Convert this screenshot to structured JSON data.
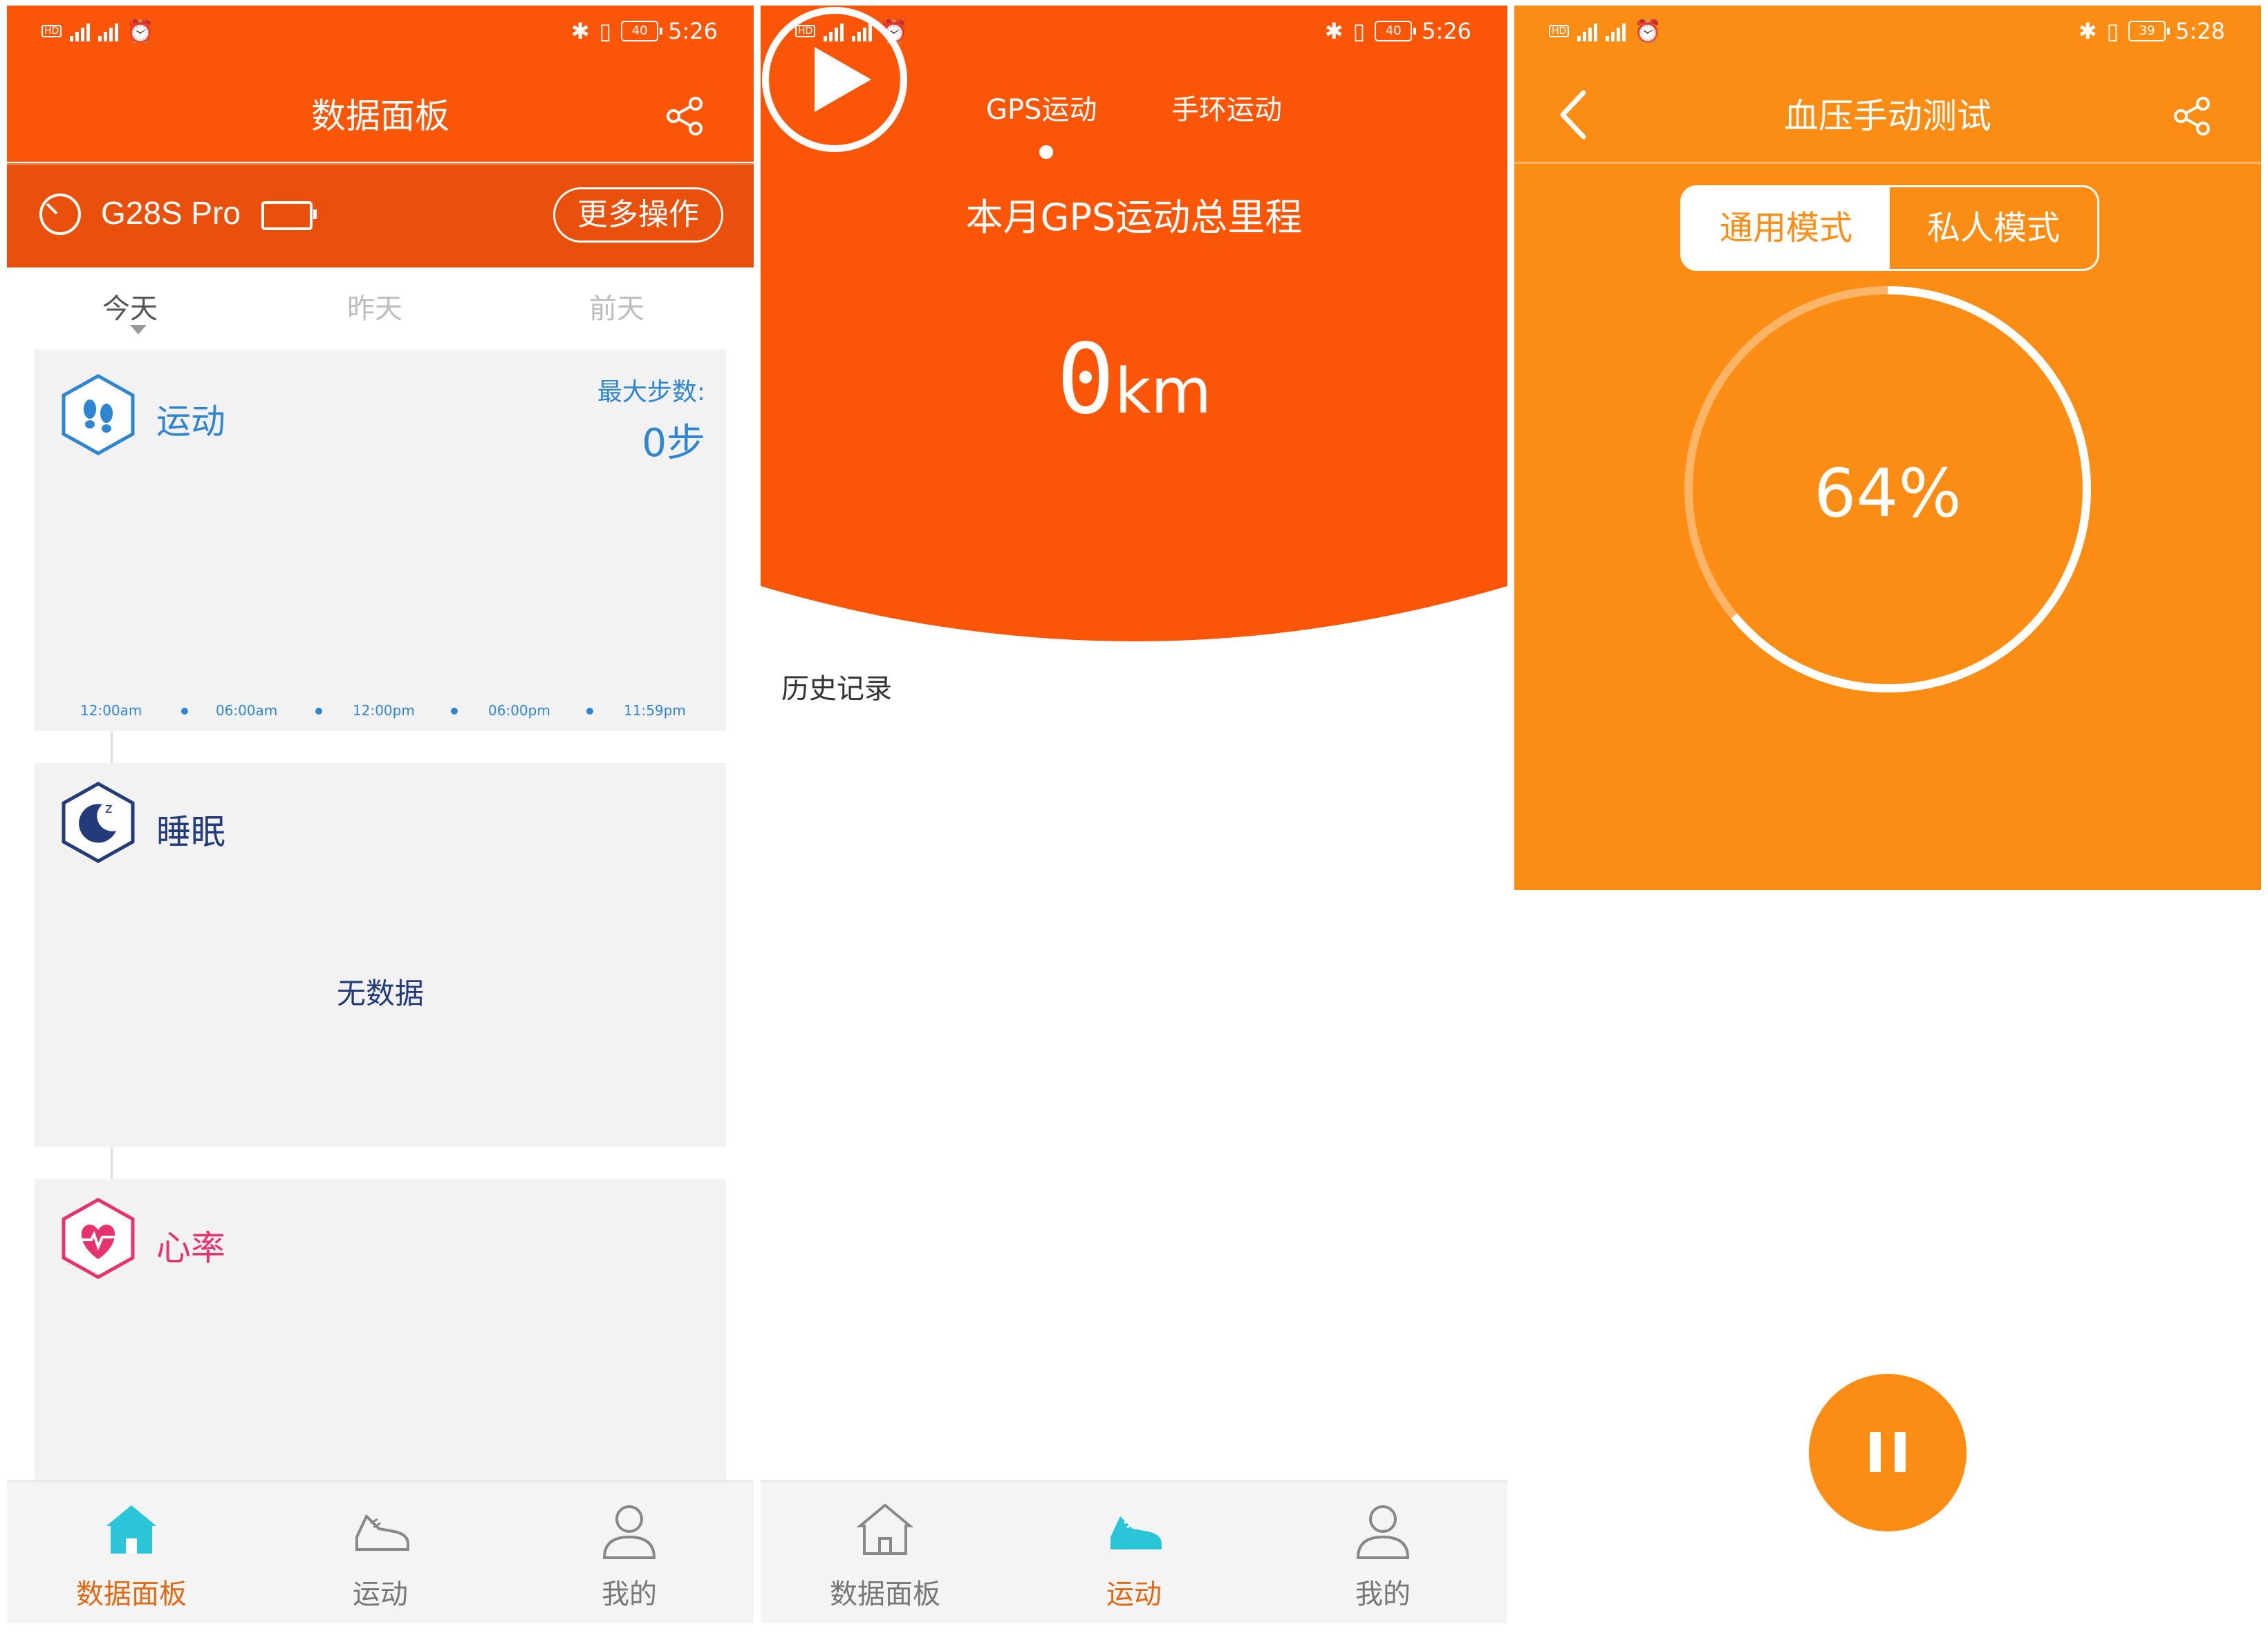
{
  "colors": {
    "orange_red": "#fb5607",
    "orange": "#fb8c14",
    "blue": "#2f86d0",
    "navy": "#243b7a",
    "pink": "#e8326e",
    "teal": "#2bc5d8"
  },
  "status_times": [
    "5:26",
    "5:26",
    "5:28"
  ],
  "battery_levels": [
    "40",
    "40",
    "39"
  ],
  "dashboard": {
    "title": "数据面板",
    "device_name": "G28S Pro",
    "more_actions": "更多操作",
    "day_tabs": [
      "今天",
      "昨天",
      "前天"
    ],
    "sport": {
      "title": "运动",
      "max_steps_label": "最大步数:",
      "max_steps_value": "0步",
      "axis_labels": [
        "12:00am",
        "06:00am",
        "12:00pm",
        "06:00pm",
        "11:59pm"
      ]
    },
    "sleep": {
      "title": "睡眠",
      "no_data": "无数据"
    },
    "heart": {
      "title": "心率"
    }
  },
  "nav": {
    "items": [
      {
        "label": "数据面板",
        "icon": "home-icon"
      },
      {
        "label": "运动",
        "icon": "sneaker-icon"
      },
      {
        "label": "我的",
        "icon": "person-icon"
      }
    ]
  },
  "gps": {
    "tabs": [
      "GPS运动",
      "手环运动"
    ],
    "title": "本月GPS运动总里程",
    "value": "0",
    "unit": "km",
    "history": "历史记录"
  },
  "bp": {
    "title": "血压手动测试",
    "modes": [
      "通用模式",
      "私人模式"
    ],
    "progress_percent": 64,
    "progress_text": "64%"
  }
}
